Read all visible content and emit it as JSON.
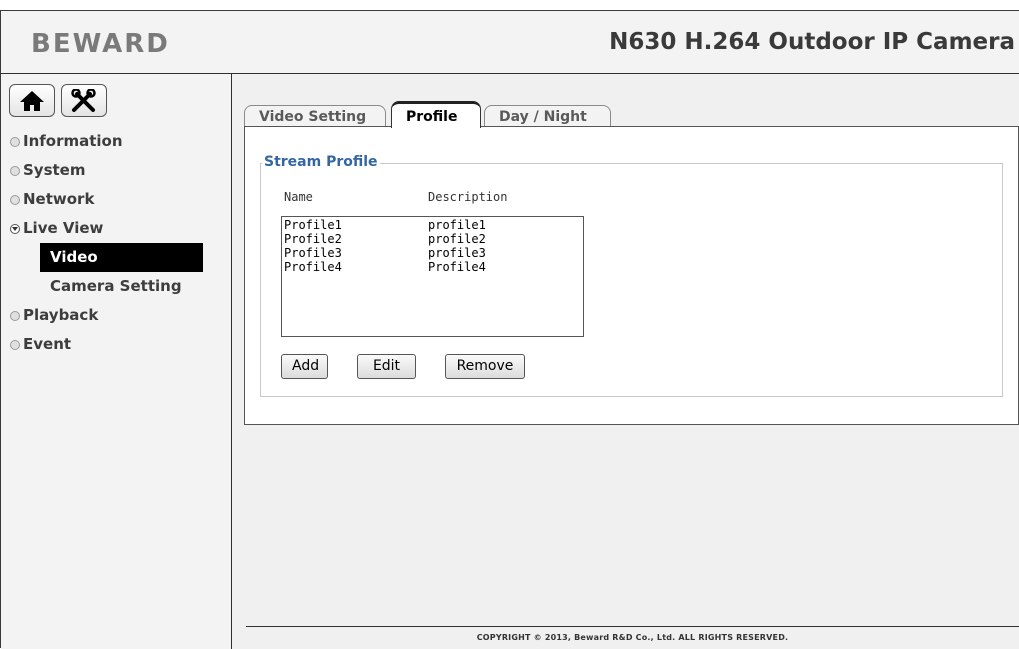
{
  "header": {
    "logo": "BEWARD",
    "title": "N630 H.264 Outdoor IP Camera"
  },
  "sidebar": {
    "home_icon": "home-icon",
    "tools_icon": "tools-icon",
    "items": [
      {
        "label": "Information"
      },
      {
        "label": "System"
      },
      {
        "label": "Network"
      },
      {
        "label": "Live View"
      },
      {
        "label": "Playback"
      },
      {
        "label": "Event"
      }
    ],
    "subitems": [
      {
        "label": "Video"
      },
      {
        "label": "Camera Setting"
      }
    ]
  },
  "tabs": [
    {
      "label": "Video Setting"
    },
    {
      "label": "Profile"
    },
    {
      "label": "Day / Night"
    }
  ],
  "stream_profile": {
    "legend": "Stream Profile",
    "col_name": "Name",
    "col_description": "Description",
    "rows": [
      {
        "name": "Profile1",
        "description": "profile1"
      },
      {
        "name": "Profile2",
        "description": "profile2"
      },
      {
        "name": "Profile3",
        "description": "profile3"
      },
      {
        "name": "Profile4",
        "description": "Profile4"
      }
    ],
    "add_label": "Add",
    "edit_label": "Edit",
    "remove_label": "Remove"
  },
  "footer": {
    "copyright": "COPYRIGHT © 2013, Beward R&D Co., Ltd. ALL RIGHTS RESERVED."
  }
}
